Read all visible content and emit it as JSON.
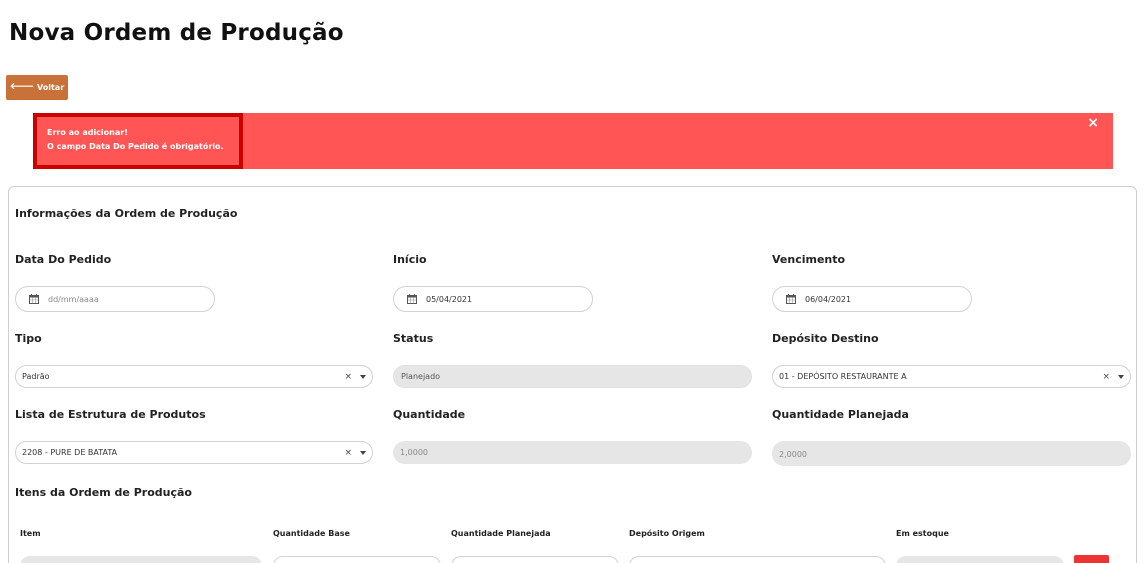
{
  "page": {
    "title": "Nova Ordem de Produção",
    "back_label": "Voltar"
  },
  "alert": {
    "line1": "Erro ao adicionar!",
    "line2": "O campo Data Do Pedido é obrigatório.",
    "close": "×",
    "color": "#ff5555"
  },
  "info": {
    "section_title": "Informações da Ordem de Produção",
    "data_pedido": {
      "label": "Data Do Pedido",
      "placeholder": "dd/mm/aaaa",
      "value": ""
    },
    "inicio": {
      "label": "Início",
      "value": "05/04/2021"
    },
    "vencimento": {
      "label": "Vencimento",
      "value": "06/04/2021"
    },
    "tipo": {
      "label": "Tipo",
      "value": "Padrão"
    },
    "status": {
      "label": "Status",
      "value": "Planejado"
    },
    "deposito_destino": {
      "label": "Depósito Destino",
      "value": "01 - DEPÓSITO RESTAURANTE A"
    },
    "lista_estrutura": {
      "label": "Lista de Estrutura de Produtos",
      "value": "2208 - PURE DE BATATA"
    },
    "quantidade": {
      "label": "Quantidade",
      "value": "1,0000"
    },
    "quantidade_planejada": {
      "label": "Quantidade Planejada",
      "value": "2,0000"
    }
  },
  "itens": {
    "section_title": "Itens da Ordem de Produção",
    "columns": [
      "Item",
      "Quantidade Base",
      "Quantidade Planejada",
      "Depósito Origem",
      "Em estoque"
    ]
  },
  "colors": {
    "accent_button": "#c8723a",
    "alert_bg": "#ff5555",
    "alert_border": "#cc0000",
    "delete_button": "#ee3333"
  }
}
